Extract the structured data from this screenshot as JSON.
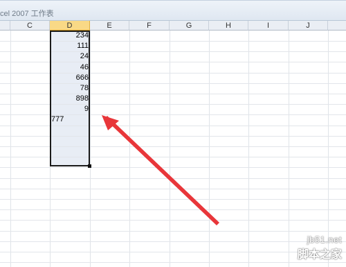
{
  "window": {
    "title_fragment": "cel 2007 工作表"
  },
  "columns": [
    "C",
    "D",
    "E",
    "F",
    "G",
    "H",
    "I",
    "J"
  ],
  "selected_column": "D",
  "cells_D": [
    "234",
    "111",
    "24",
    "46",
    "666",
    "78",
    "898",
    "9",
    "777"
  ],
  "annotation": {
    "arrow_color": "#e8363a"
  },
  "watermark": {
    "line1": "jb51.net",
    "line2": "脚本之家"
  }
}
